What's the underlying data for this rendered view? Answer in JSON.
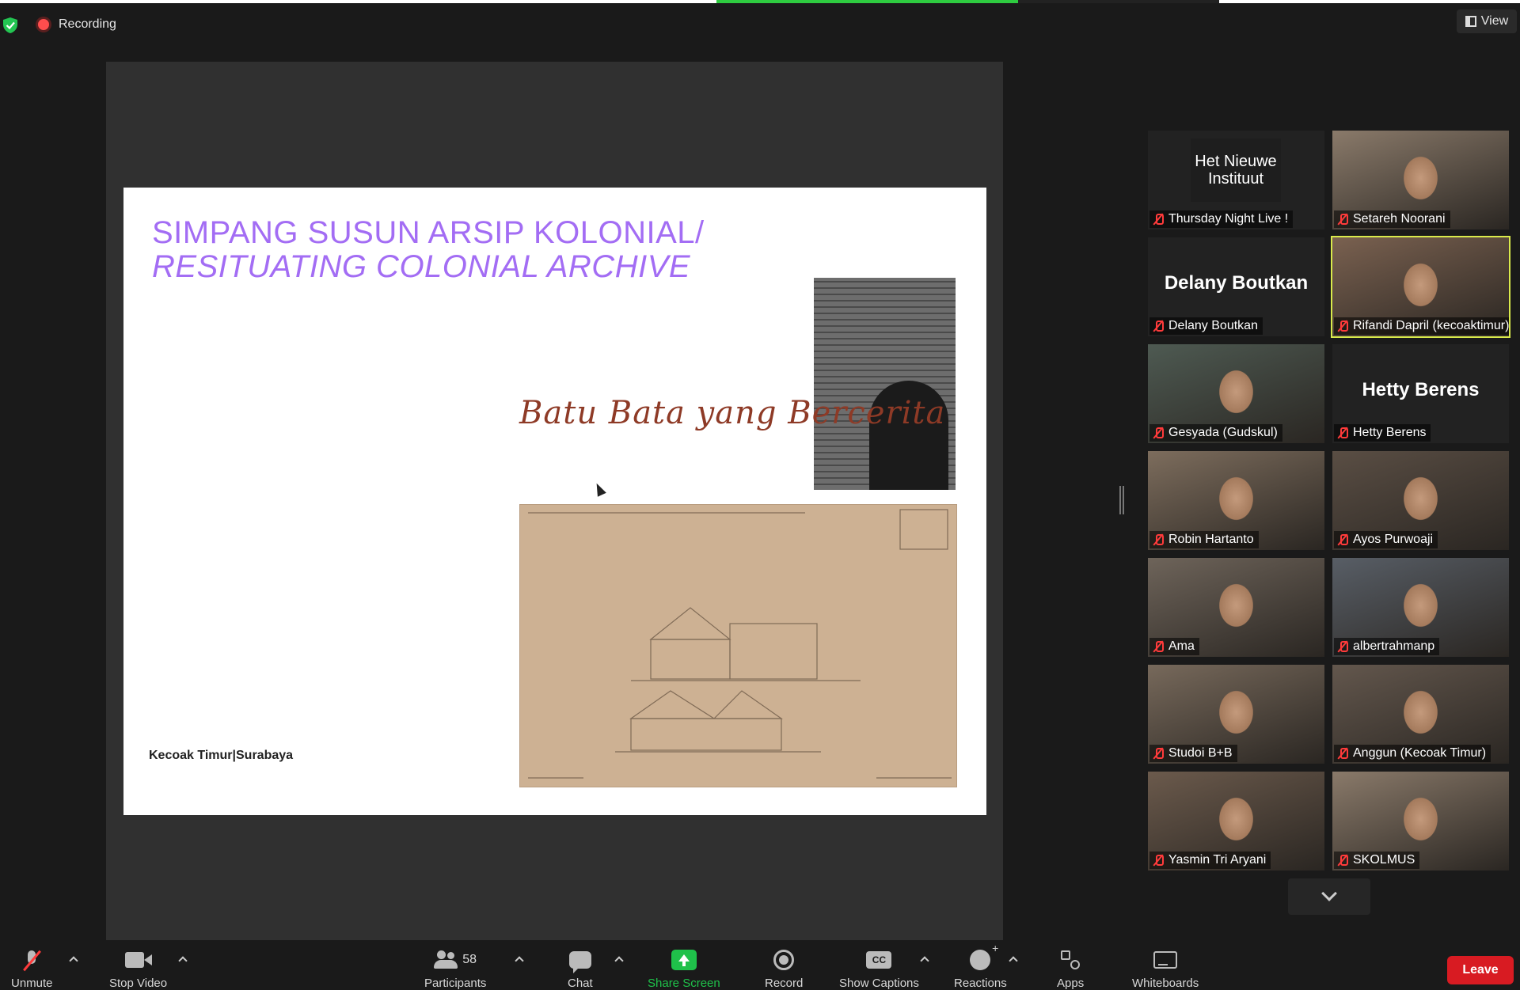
{
  "header": {
    "recording_label": "Recording",
    "view_label": "View"
  },
  "top_progress": 0.6,
  "colors": {
    "share_green": "#1fc14a",
    "leave_red": "#d81b22",
    "active_speaker": "#d9ea4b",
    "slide_title": "#a36df4"
  },
  "slide": {
    "title_line1": "SIMPANG SUSUN ARSIP KOLONIAL/",
    "title_line2": "RESITUATING COLONIAL ARCHIVE",
    "script_text": "Batu Bata yang Bercerita",
    "footer": "Kecoak Timur|Surabaya"
  },
  "gallery": {
    "tiles": [
      {
        "name": "Thursday Night Live !",
        "logo": "Het Nieuwe Instituut",
        "muted": true
      },
      {
        "name": "Setareh Noorani",
        "muted": true
      },
      {
        "name": "Delany Boutkan",
        "center_name": "Delany Boutkan",
        "muted": true
      },
      {
        "name": "Rifandi Dapril (kecoaktimur)",
        "muted": true,
        "active": true
      },
      {
        "name": "Gesyada (Gudskul)",
        "muted": true
      },
      {
        "name": "Hetty Berens",
        "center_name": "Hetty Berens",
        "muted": true
      },
      {
        "name": "Robin Hartanto",
        "muted": true
      },
      {
        "name": "Ayos Purwoaji",
        "muted": true
      },
      {
        "name": "Ama",
        "muted": true
      },
      {
        "name": "albertrahmanp",
        "muted": true
      },
      {
        "name": "Studoi B+B",
        "muted": true
      },
      {
        "name": "Anggun (Kecoak Timur)",
        "muted": true
      },
      {
        "name": "Yasmin Tri Aryani",
        "muted": true
      },
      {
        "name": "SKOLMUS",
        "muted": true
      }
    ]
  },
  "toolbar": {
    "unmute": "Unmute",
    "stop_video": "Stop Video",
    "participants": "Participants",
    "participants_count": "58",
    "chat": "Chat",
    "share_screen": "Share Screen",
    "record": "Record",
    "show_captions": "Show Captions",
    "cc": "CC",
    "reactions": "Reactions",
    "apps": "Apps",
    "whiteboards": "Whiteboards",
    "leave": "Leave"
  },
  "icons": [
    "shield-check-icon",
    "recording-dot-icon",
    "view-layout-icon",
    "muted-mic-icon",
    "video-camera-icon",
    "participants-icon",
    "chat-bubble-icon",
    "share-screen-icon",
    "record-icon",
    "captions-icon",
    "reactions-icon",
    "apps-icon",
    "whiteboard-icon",
    "chevron-down-icon"
  ]
}
